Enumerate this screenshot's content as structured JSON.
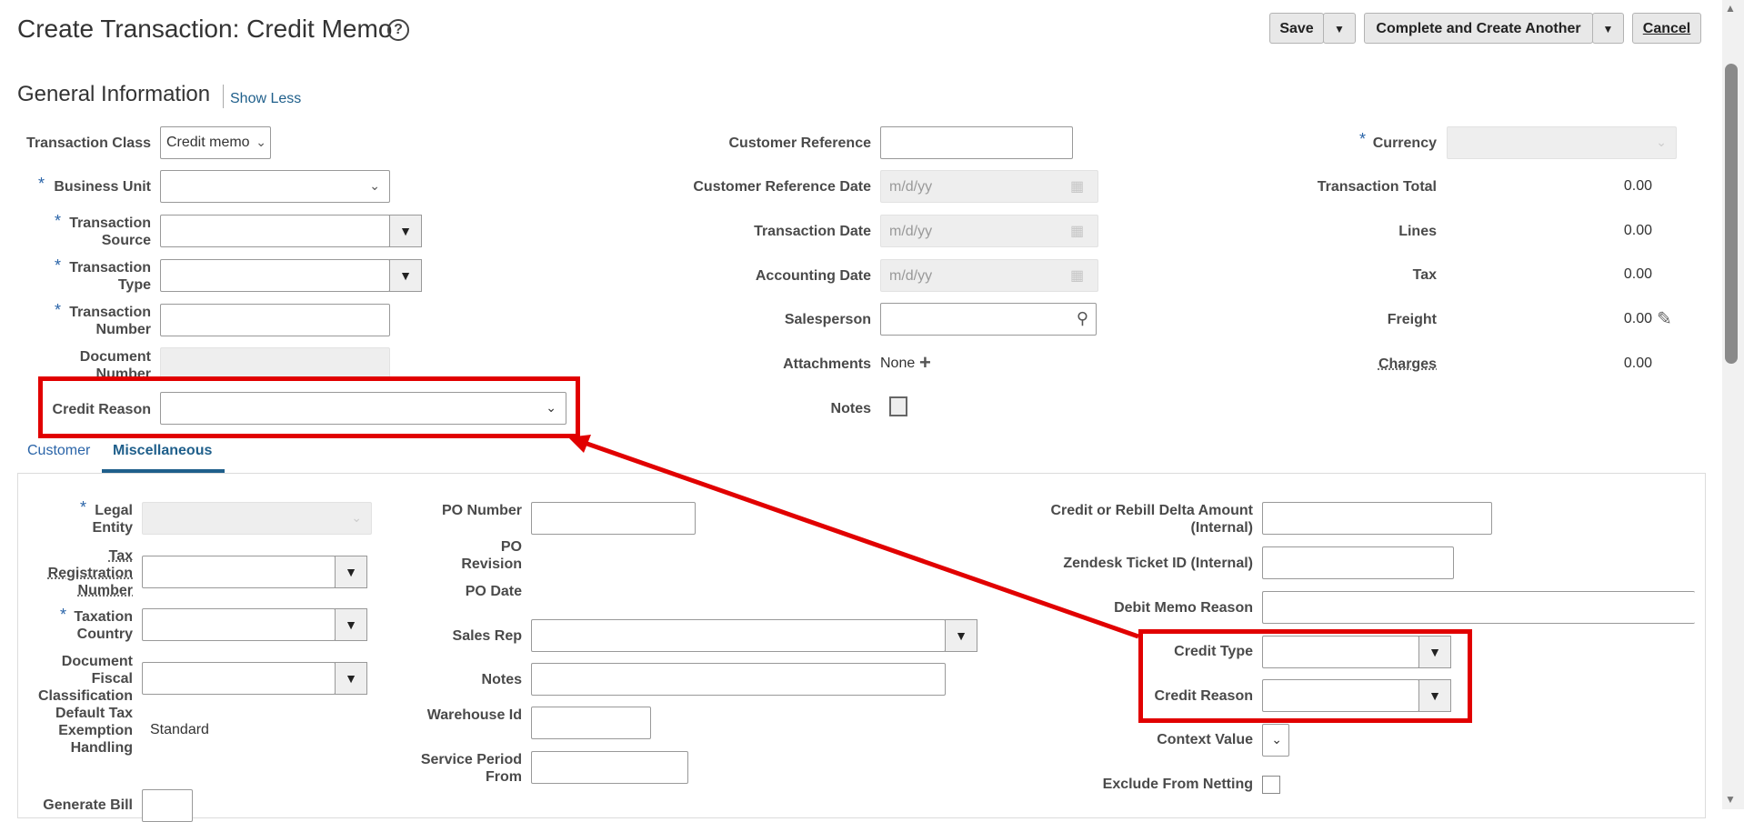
{
  "header": {
    "title": "Create Transaction: Credit Memo",
    "save_label": "Save",
    "complete_label": "Complete and Create Another",
    "cancel_label": "Cancel"
  },
  "general": {
    "title": "General Information",
    "show_less": "Show Less"
  },
  "left": {
    "transaction_class_label": "Transaction Class",
    "transaction_class_value": "Credit memo",
    "business_unit_label": "Business Unit",
    "transaction_source_label": "Transaction Source",
    "transaction_type_label": "Transaction Type",
    "transaction_number_label": "Transaction Number",
    "document_number_label": "Document Number",
    "credit_reason_label": "Credit Reason"
  },
  "middle": {
    "customer_reference_label": "Customer Reference",
    "customer_reference_date_label": "Customer Reference Date",
    "transaction_date_label": "Transaction Date",
    "accounting_date_label": "Accounting Date",
    "date_placeholder": "m/d/yy",
    "salesperson_label": "Salesperson",
    "attachments_label": "Attachments",
    "attachments_value": "None",
    "notes_label": "Notes"
  },
  "right": {
    "currency_label": "Currency",
    "transaction_total_label": "Transaction Total",
    "transaction_total_value": "0.00",
    "lines_label": "Lines",
    "lines_value": "0.00",
    "tax_label": "Tax",
    "tax_value": "0.00",
    "freight_label": "Freight",
    "freight_value": "0.00",
    "charges_label": "Charges",
    "charges_value": "0.00"
  },
  "tabs": [
    {
      "label": "Customer"
    },
    {
      "label": "Miscellaneous"
    }
  ],
  "misc": {
    "legal_entity_label": "Legal Entity",
    "tax_registration_label": "Tax Registration Number",
    "taxation_country_label": "Taxation Country",
    "document_fiscal_label": "Document Fiscal Classification",
    "default_tax_label": "Default Tax Exemption Handling",
    "default_tax_value": "Standard",
    "generate_bill_label": "Generate Bill",
    "po_number_label": "PO Number",
    "po_revision_label": "PO Revision",
    "po_date_label": "PO Date",
    "sales_rep_label": "Sales Rep",
    "notes_label": "Notes",
    "warehouse_label": "Warehouse Id",
    "service_period_label": "Service Period From",
    "credit_rebill_label": "Credit or Rebill Delta Amount (Internal)",
    "zendesk_label": "Zendesk Ticket ID (Internal)",
    "debit_memo_reason_label": "Debit Memo Reason",
    "credit_type_label": "Credit Type",
    "credit_reason_label": "Credit Reason",
    "context_value_label": "Context Value",
    "exclude_netting_label": "Exclude From Netting"
  },
  "colors": {
    "accent": "#1f5f8b",
    "annotation": "#e10000"
  }
}
